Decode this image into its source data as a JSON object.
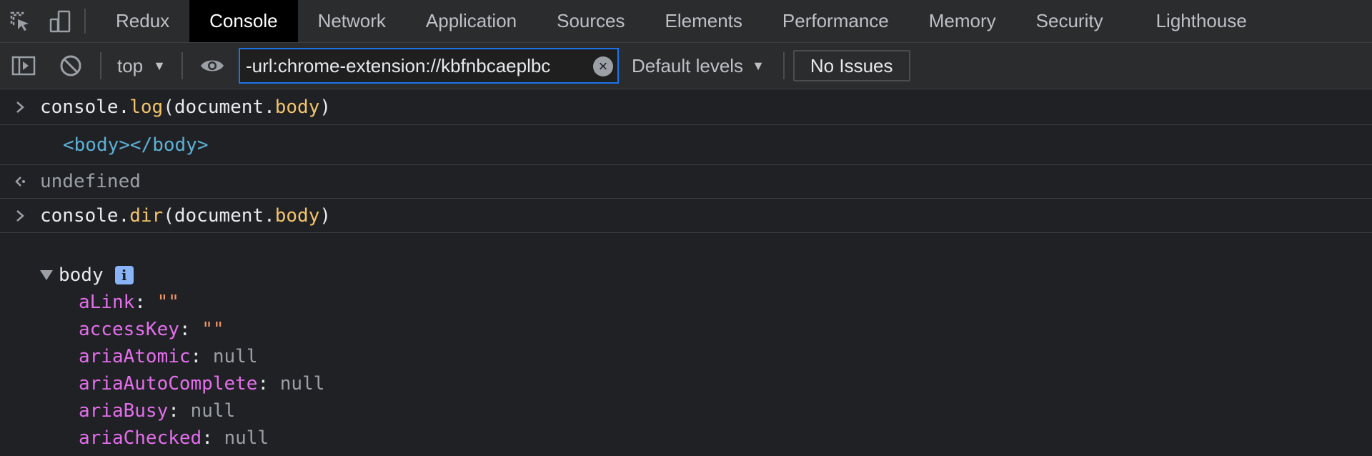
{
  "tabs": [
    {
      "label": "Redux",
      "active": false
    },
    {
      "label": "Console",
      "active": true
    },
    {
      "label": "Network",
      "active": false
    },
    {
      "label": "Application",
      "active": false
    },
    {
      "label": "Sources",
      "active": false
    },
    {
      "label": "Elements",
      "active": false
    },
    {
      "label": "Performance",
      "active": false
    },
    {
      "label": "Memory",
      "active": false
    },
    {
      "label": "Security",
      "active": false
    },
    {
      "label": "Lighthouse",
      "active": false
    }
  ],
  "toolbar": {
    "context": "top",
    "filter_value": "-url:chrome-extension://kbfnbcaeplbc",
    "levels": "Default levels",
    "issues": "No Issues"
  },
  "console": {
    "entry1": {
      "obj": "console",
      "dot": ".",
      "method": "log",
      "open": "(",
      "arg": "document",
      "dot2": ".",
      "prop": "body",
      "close": ")"
    },
    "output1": "<body></body>",
    "return1": "undefined",
    "entry2": {
      "obj": "console",
      "dot": ".",
      "method": "dir",
      "open": "(",
      "arg": "document",
      "dot2": ".",
      "prop": "body",
      "close": ")"
    },
    "tree": {
      "label": "body",
      "badge": "i",
      "properties": [
        {
          "key": "aLink",
          "value": "\"\"",
          "type": "string"
        },
        {
          "key": "accessKey",
          "value": "\"\"",
          "type": "string"
        },
        {
          "key": "ariaAtomic",
          "value": "null",
          "type": "null"
        },
        {
          "key": "ariaAutoComplete",
          "value": "null",
          "type": "null"
        },
        {
          "key": "ariaBusy",
          "value": "null",
          "type": "null"
        },
        {
          "key": "ariaChecked",
          "value": "null",
          "type": "null"
        }
      ]
    }
  },
  "colors": {
    "active_tab_bg": "#000000",
    "filter_focus_border": "#1a73e8",
    "key_color": "#e36eec",
    "string_color": "#f29766",
    "method_color": "#f3c36b",
    "tag_color": "#5db0d7"
  }
}
